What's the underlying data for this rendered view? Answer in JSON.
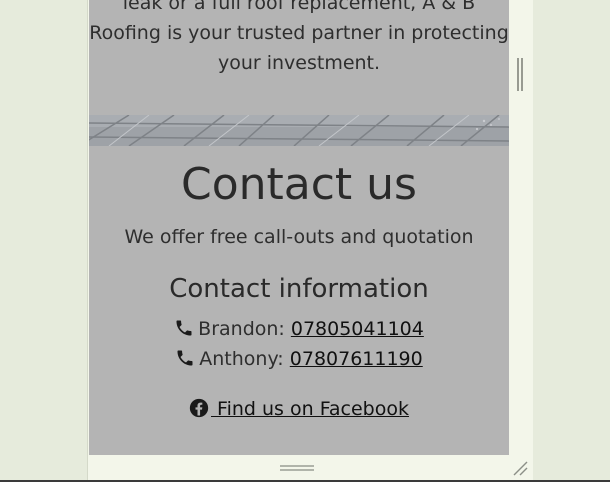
{
  "about": {
    "text": "leak or a full roof replacement, A & B Roofing is your trusted partner in protecting your investment."
  },
  "contact": {
    "title": "Contact us",
    "subtitle": "We offer free call-outs and quotation",
    "info_title": "Contact information",
    "phones": [
      {
        "label": "Brandon: ",
        "number": "07805041104",
        "icon": "phone-icon"
      },
      {
        "label": "Anthony: ",
        "number": "07807611190",
        "icon": "phone-icon"
      }
    ],
    "facebook": {
      "label": " Find us on Facebook",
      "icon": "facebook-icon"
    }
  },
  "colors": {
    "page_bg": "#e6ebdc",
    "frame_bg": "#f3f6ea",
    "content_bg": "#b4b4b4",
    "text": "#2b2b2b",
    "link": "#111111"
  }
}
